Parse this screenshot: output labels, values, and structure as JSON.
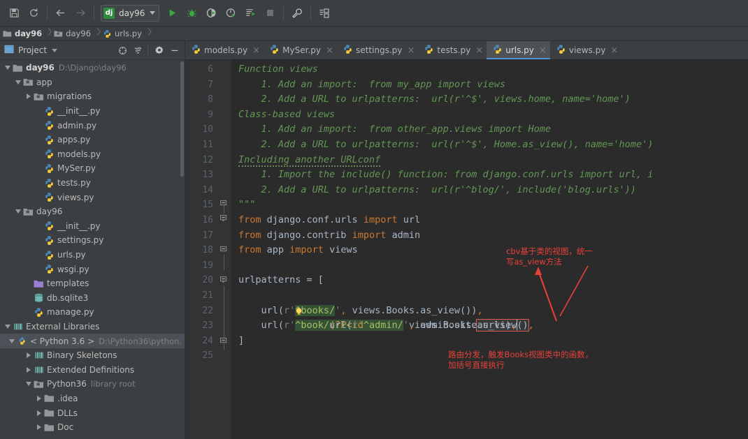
{
  "toolbar": {
    "buttons": [
      {
        "name": "save-all-button",
        "icon": "save-icon"
      },
      {
        "name": "sync-button",
        "icon": "refresh-icon"
      },
      {
        "name": "back-button",
        "icon": "arrow-left-icon"
      },
      {
        "name": "forward-button",
        "icon": "arrow-right-icon"
      }
    ],
    "run_config": {
      "badge": "dj",
      "name": "day96",
      "dropdown_icon": "chevron-down-icon"
    },
    "run_buttons": [
      {
        "name": "run-button",
        "icon": "play-icon"
      },
      {
        "name": "debug-button",
        "icon": "bug-icon"
      },
      {
        "name": "run-coverage-button",
        "icon": "coverage-icon"
      },
      {
        "name": "profile-button",
        "icon": "profile-icon"
      },
      {
        "name": "run-with-console-button",
        "icon": "console-run-icon"
      },
      {
        "name": "stop-button",
        "icon": "stop-icon"
      },
      {
        "name": "settings-button",
        "icon": "wrench-icon"
      },
      {
        "name": "project-structure-button",
        "icon": "module-settings-icon"
      }
    ]
  },
  "breadcrumbs": [
    {
      "label": "day96",
      "icon": "project-folder-icon"
    },
    {
      "label": "day96",
      "icon": "module-folder-icon"
    },
    {
      "label": "urls.py",
      "icon": "python-file-icon"
    }
  ],
  "project_panel": {
    "title": "Project",
    "header_icons": [
      {
        "name": "scope-icon"
      },
      {
        "name": "collapse-all-icon"
      },
      {
        "name": "gear-icon"
      },
      {
        "name": "hide-icon"
      }
    ],
    "tree": [
      {
        "label": "day96",
        "sub": "D:\\Django\\day96",
        "icon": "project-folder-icon",
        "indent": 0,
        "arrow": "expanded",
        "bold": true
      },
      {
        "label": "app",
        "sub": "",
        "icon": "module-folder-icon",
        "indent": 1,
        "arrow": "expanded"
      },
      {
        "label": "migrations",
        "sub": "",
        "icon": "module-folder-icon",
        "indent": 2,
        "arrow": "collapsed"
      },
      {
        "label": "__init__.py",
        "sub": "",
        "icon": "python-file-icon",
        "indent": 3,
        "arrow": ""
      },
      {
        "label": "admin.py",
        "sub": "",
        "icon": "python-file-icon",
        "indent": 3,
        "arrow": ""
      },
      {
        "label": "apps.py",
        "sub": "",
        "icon": "python-file-icon",
        "indent": 3,
        "arrow": ""
      },
      {
        "label": "models.py",
        "sub": "",
        "icon": "python-file-icon",
        "indent": 3,
        "arrow": ""
      },
      {
        "label": "MySer.py",
        "sub": "",
        "icon": "python-file-icon",
        "indent": 3,
        "arrow": ""
      },
      {
        "label": "tests.py",
        "sub": "",
        "icon": "python-file-icon",
        "indent": 3,
        "arrow": ""
      },
      {
        "label": "views.py",
        "sub": "",
        "icon": "python-file-icon",
        "indent": 3,
        "arrow": ""
      },
      {
        "label": "day96",
        "sub": "",
        "icon": "module-folder-icon",
        "indent": 1,
        "arrow": "expanded"
      },
      {
        "label": "__init__.py",
        "sub": "",
        "icon": "python-file-icon",
        "indent": 3,
        "arrow": ""
      },
      {
        "label": "settings.py",
        "sub": "",
        "icon": "python-file-icon",
        "indent": 3,
        "arrow": ""
      },
      {
        "label": "urls.py",
        "sub": "",
        "icon": "python-file-icon",
        "indent": 3,
        "arrow": ""
      },
      {
        "label": "wsgi.py",
        "sub": "",
        "icon": "python-file-icon",
        "indent": 3,
        "arrow": ""
      },
      {
        "label": "templates",
        "sub": "",
        "icon": "templates-folder-icon",
        "indent": 2,
        "arrow": ""
      },
      {
        "label": "db.sqlite3",
        "sub": "",
        "icon": "database-icon",
        "indent": 2,
        "arrow": ""
      },
      {
        "label": "manage.py",
        "sub": "",
        "icon": "python-file-icon",
        "indent": 2,
        "arrow": ""
      },
      {
        "label": "External Libraries",
        "sub": "",
        "icon": "library-icon",
        "indent": 0,
        "arrow": "expanded"
      },
      {
        "label": "< Python 3.6 >",
        "sub": "D:\\Python36\\python.",
        "icon": "python-sdk-icon",
        "indent": 1,
        "arrow": "expanded",
        "selected": true
      },
      {
        "label": "Binary Skeletons",
        "sub": "",
        "icon": "library-icon",
        "indent": 2,
        "arrow": "collapsed"
      },
      {
        "label": "Extended Definitions",
        "sub": "",
        "icon": "library-icon",
        "indent": 2,
        "arrow": "collapsed"
      },
      {
        "label": "Python36",
        "sub": "library root",
        "icon": "module-folder-icon",
        "indent": 2,
        "arrow": "expanded"
      },
      {
        "label": ".idea",
        "sub": "",
        "icon": "folder-icon",
        "indent": 3,
        "arrow": "collapsed"
      },
      {
        "label": "DLLs",
        "sub": "",
        "icon": "folder-icon",
        "indent": 3,
        "arrow": "collapsed"
      },
      {
        "label": "Doc",
        "sub": "",
        "icon": "folder-icon",
        "indent": 3,
        "arrow": "collapsed"
      }
    ]
  },
  "editor": {
    "tabs": [
      {
        "label": "models.py",
        "active": false
      },
      {
        "label": "MySer.py",
        "active": false
      },
      {
        "label": "settings.py",
        "active": false
      },
      {
        "label": "tests.py",
        "active": false
      },
      {
        "label": "urls.py",
        "active": true
      },
      {
        "label": "views.py",
        "active": false
      }
    ],
    "close_glyph": "×",
    "line_numbers": [
      6,
      7,
      8,
      9,
      10,
      11,
      12,
      13,
      14,
      15,
      16,
      17,
      18,
      19,
      20,
      21,
      22,
      23,
      24,
      25
    ],
    "lines": [
      {
        "n": 6,
        "text": "Function views"
      },
      {
        "n": 7,
        "text": "    1. Add an import:  from my_app import views"
      },
      {
        "n": 8,
        "text": "    2. Add a URL to urlpatterns:  url(r'^$', views.home, name='home')"
      },
      {
        "n": 9,
        "text": "Class-based views"
      },
      {
        "n": 10,
        "text": "    1. Add an import:  from other_app.views import Home"
      },
      {
        "n": 11,
        "text": "    2. Add a URL to urlpatterns:  url(r'^$', Home.as_view(), name='home')"
      },
      {
        "n": 12,
        "text": "Including another URLconf"
      },
      {
        "n": 13,
        "text": "    1. Import the include() function: from django.conf.urls import url, i"
      },
      {
        "n": 14,
        "text": "    2. Add a URL to urlpatterns:  url(r'^blog/', include('blog.urls'))"
      },
      {
        "n": 15,
        "text": "\"\"\""
      },
      {
        "n": 16,
        "text": "from django.conf.urls import url"
      },
      {
        "n": 17,
        "text": "from django.contrib import admin"
      },
      {
        "n": 18,
        "text": "from app import views"
      },
      {
        "n": 19,
        "text": ""
      },
      {
        "n": 20,
        "text": "urlpatterns = ["
      },
      {
        "n": 21,
        "text": "    url(r'^admin/', admin.site.urls),"
      },
      {
        "n": 22,
        "text": "    url(r'^books/', views.Books.as_view()),"
      },
      {
        "n": 23,
        "text": "    url(r'^book/(?P<id>\\d+)', views.Books.as_view()),"
      },
      {
        "n": 24,
        "text": "]"
      },
      {
        "n": 25,
        "text": ""
      }
    ],
    "highlighted_token": "as_view()",
    "annotations": [
      {
        "name": "annotation-cbv",
        "text": "cbv基于类的视图，统一\n写as_view方法",
        "color": "#e8413a"
      },
      {
        "name": "annotation-routing",
        "text": "路由分发，触发Books视图类中的函数，\n加括号直接执行",
        "color": "#e8413a"
      }
    ]
  },
  "colors": {
    "chrome": "#3c3f41",
    "editor_bg": "#2b2b2b",
    "gutter_bg": "#313335",
    "accent_tab": "#4b93d1",
    "docstring": "#629755",
    "keyword": "#cc7832",
    "string": "#6a8759",
    "plain": "#a9b7c6",
    "annotation": "#e8413a",
    "selection": "#4b5156"
  }
}
